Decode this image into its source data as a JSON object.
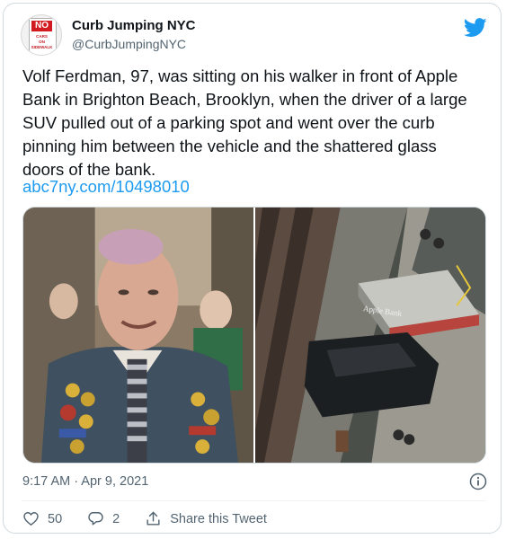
{
  "author": {
    "name": "Curb Jumping NYC",
    "handle": "@CurbJumpingNYC",
    "avatar_sign": {
      "top": "NO",
      "lines": [
        "CARS",
        "ON",
        "SIDEWALK"
      ]
    }
  },
  "tweet": {
    "text": "Volf Ferdman, 97, was sitting on his walker in front of Apple\nBank in Brighton Beach, Brooklyn, when the  driver of a large\nSUV pulled out of a parking spot and went over the curb\npinning him between the vehicle and the shattered glass\ndoors of the bank.",
    "link": "abc7ny.com/10498010",
    "timestamp": "9:17 AM · Apr 9, 2021"
  },
  "media": {
    "photos": [
      {
        "subject": "elderly-man-portrait"
      },
      {
        "subject": "aerial-crash-scene",
        "sign_text": "Apple Bank"
      }
    ]
  },
  "actions": {
    "likes": "50",
    "replies": "2",
    "share_label": "Share this Tweet"
  },
  "colors": {
    "accent": "#1d9bf0",
    "text": "#0f1419",
    "muted": "#536471",
    "sign_red": "#d21b20"
  },
  "icons": [
    "twitter-bird-icon",
    "info-icon",
    "heart-icon",
    "reply-icon",
    "share-icon"
  ]
}
